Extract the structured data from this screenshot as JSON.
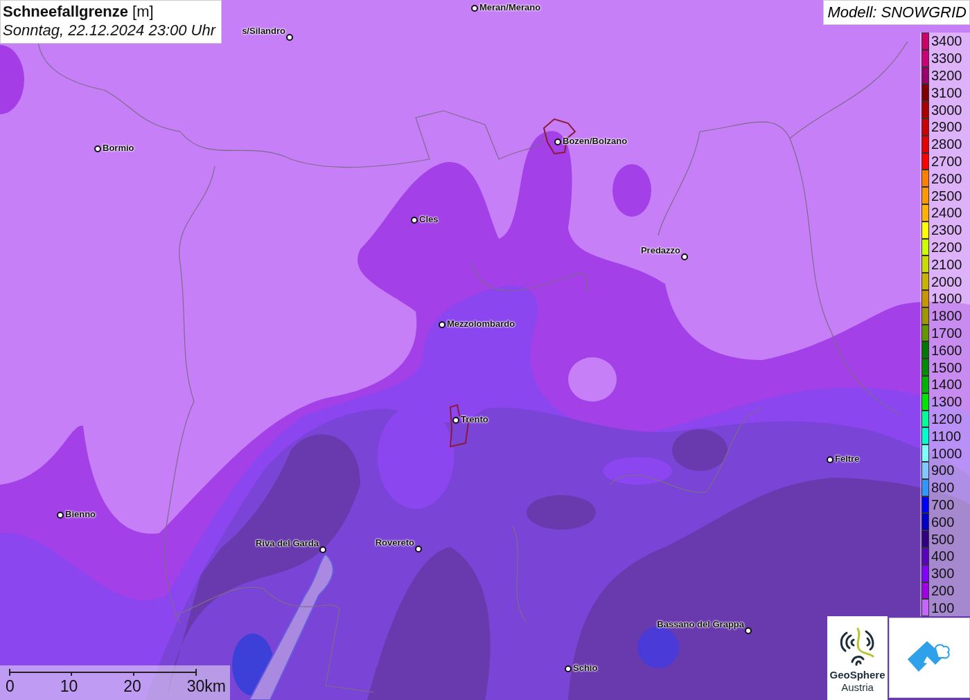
{
  "title": {
    "heading": "**Schneefallgrenze** [m]",
    "datetime": "Sonntag, 22.12.2024 23:00 Uhr"
  },
  "model_label": "Modell: SNOWGRID",
  "places": [
    {
      "name": "Meran/Merano"
    },
    {
      "name": "s/Silandro"
    },
    {
      "name": "Bormio"
    },
    {
      "name": "Bozen/Bolzano"
    },
    {
      "name": "Cles"
    },
    {
      "name": "Predazzo"
    },
    {
      "name": "Mezzolombardo"
    },
    {
      "name": "Trento"
    },
    {
      "name": "Feltre"
    },
    {
      "name": "Bienno"
    },
    {
      "name": "Riva del Garda"
    },
    {
      "name": "Rovereto"
    },
    {
      "name": "Bassano del Grappa"
    },
    {
      "name": "Schio"
    }
  ],
  "legend": [
    {
      "label": "3400",
      "color": "#cc0066"
    },
    {
      "label": "3300",
      "color": "#cc0077"
    },
    {
      "label": "3200",
      "color": "#99006b"
    },
    {
      "label": "3100",
      "color": "#800000"
    },
    {
      "label": "3000",
      "color": "#aa0000"
    },
    {
      "label": "2900",
      "color": "#cc0000"
    },
    {
      "label": "2800",
      "color": "#e60000"
    },
    {
      "label": "2700",
      "color": "#ff0000"
    },
    {
      "label": "2600",
      "color": "#ff7f00"
    },
    {
      "label": "2500",
      "color": "#ff9900"
    },
    {
      "label": "2400",
      "color": "#ffb300"
    },
    {
      "label": "2300",
      "color": "#ffff00"
    },
    {
      "label": "2200",
      "color": "#ccff00"
    },
    {
      "label": "2100",
      "color": "#c8dc00"
    },
    {
      "label": "2000",
      "color": "#c8b400"
    },
    {
      "label": "1900",
      "color": "#c89600"
    },
    {
      "label": "1800",
      "color": "#a09600"
    },
    {
      "label": "1700",
      "color": "#649600"
    },
    {
      "label": "1600",
      "color": "#007800"
    },
    {
      "label": "1500",
      "color": "#008c00"
    },
    {
      "label": "1400",
      "color": "#00b400"
    },
    {
      "label": "1300",
      "color": "#00e600"
    },
    {
      "label": "1200",
      "color": "#00ff96"
    },
    {
      "label": "1100",
      "color": "#00ffcc"
    },
    {
      "label": "1000",
      "color": "#80ffff"
    },
    {
      "label": "900",
      "color": "#80c8ff"
    },
    {
      "label": "800",
      "color": "#3296ff"
    },
    {
      "label": "700",
      "color": "#0000ff"
    },
    {
      "label": "600",
      "color": "#0000c8"
    },
    {
      "label": "500",
      "color": "#320082"
    },
    {
      "label": "400",
      "color": "#5a00be"
    },
    {
      "label": "300",
      "color": "#8200ff"
    },
    {
      "label": "200",
      "color": "#a000e6"
    },
    {
      "label": "100",
      "color": "#c864ff"
    }
  ],
  "scale_bar": {
    "ticks": [
      "0",
      "10",
      "20",
      "30km"
    ]
  },
  "logos": [
    {
      "kind": "geosphere",
      "lines": [
        "GeoSphere",
        "Austria"
      ]
    },
    {
      "kind": "roof-cloud"
    }
  ]
}
